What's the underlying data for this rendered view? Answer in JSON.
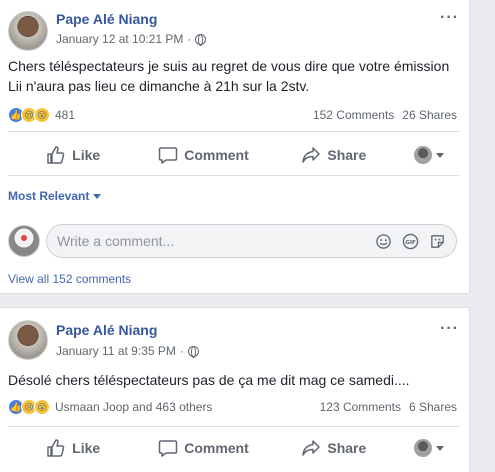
{
  "posts": [
    {
      "author": "Pape Alé Niang",
      "time": "January 12 at 10:21 PM",
      "more": "···",
      "text": "Chers téléspectateurs je suis au regret de vous dire que votre émission Lii n'aura pas lieu ce dimanche à 21h sur la 2stv.",
      "reaction_count": "481",
      "comments": "152 Comments",
      "shares": "26 Shares",
      "actions": {
        "like": "Like",
        "comment": "Comment",
        "share": "Share"
      },
      "sort_label": "Most Relevant",
      "comment_placeholder": "Write a comment...",
      "view_all": "View all 152 comments"
    },
    {
      "author": "Pape Alé Niang",
      "time": "January 11 at 9:35 PM",
      "more": "···",
      "text": "Désolé chers téléspectateurs pas de ça me dit mag ce samedi....",
      "reaction_count": "Usmaan Joop and 463 others",
      "comments": "123 Comments",
      "shares": "6 Shares",
      "actions": {
        "like": "Like",
        "comment": "Comment",
        "share": "Share"
      }
    }
  ],
  "icons": [
    "globe-icon",
    "more-icon",
    "like-reaction-icon",
    "sad-reaction-icon",
    "wow-reaction-icon",
    "thumbs-up-icon",
    "comment-icon",
    "share-icon",
    "emoji-icon",
    "gif-icon",
    "sticker-icon"
  ],
  "colors": {
    "link": "#365899",
    "accent": "#4267b2",
    "muted": "#606770",
    "background": "#e9ebee"
  }
}
